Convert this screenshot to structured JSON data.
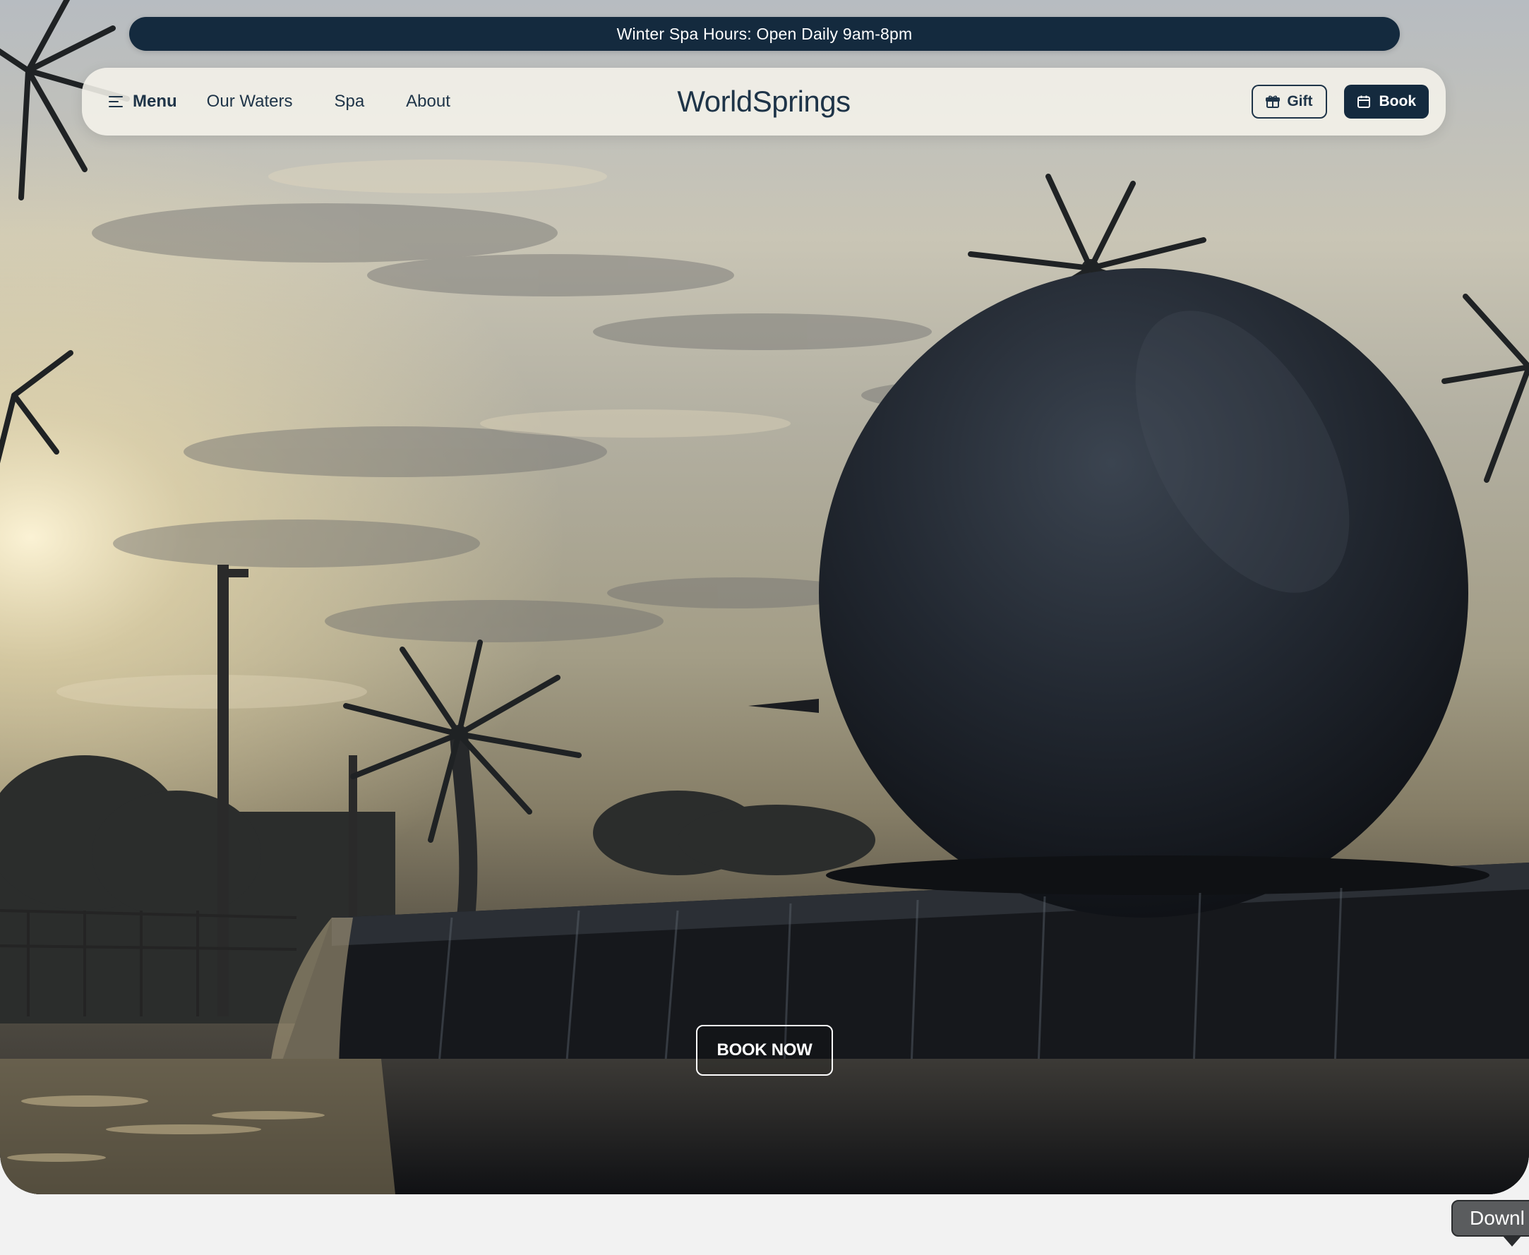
{
  "announcement": {
    "text": "Winter Spa Hours: Open Daily 9am-8pm"
  },
  "nav": {
    "menu_label": "Menu",
    "links": [
      {
        "label": "Our Waters"
      },
      {
        "label": "Spa"
      },
      {
        "label": "About"
      }
    ],
    "logo": "WorldSprings",
    "gift_label": "Gift",
    "book_label": "Book"
  },
  "hero": {
    "cta_label": "BOOK NOW"
  },
  "download_tab": {
    "label": "Downl"
  },
  "colors": {
    "navy": "#142a3e",
    "nav_text": "#1e3448",
    "nav_bg": "#f5f2ea"
  },
  "icons": {
    "menu": "menu-lines-icon",
    "gift": "gift-icon",
    "book": "calendar-icon"
  }
}
